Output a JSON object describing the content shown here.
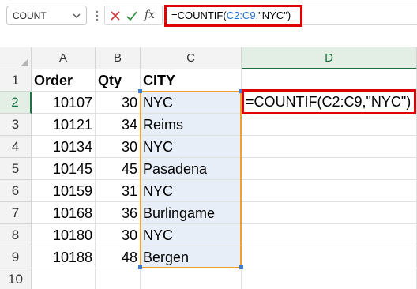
{
  "formula_bar": {
    "name_box": "COUNT",
    "formula_prefix": "=COUNTIF(",
    "formula_ref": "C2:C9",
    "formula_suffix": ",\"NYC\")",
    "fx_label": "fx",
    "icons": [
      "chevron-down-icon",
      "more-options-icon",
      "cancel-x-icon",
      "confirm-check-icon",
      "function-fx-icon"
    ]
  },
  "columns": [
    "A",
    "B",
    "C",
    "D"
  ],
  "rows": [
    "1",
    "2",
    "3",
    "4",
    "5",
    "6",
    "7",
    "8",
    "9",
    "10"
  ],
  "headers": {
    "order": "Order",
    "qty": "Qty",
    "city": "CITY"
  },
  "data": [
    {
      "order": "10107",
      "qty": "30",
      "city": "NYC"
    },
    {
      "order": "10121",
      "qty": "34",
      "city": "Reims"
    },
    {
      "order": "10134",
      "qty": "30",
      "city": "NYC"
    },
    {
      "order": "10145",
      "qty": "45",
      "city": "Pasadena"
    },
    {
      "order": "10159",
      "qty": "31",
      "city": "NYC"
    },
    {
      "order": "10168",
      "qty": "36",
      "city": "Burlingame"
    },
    {
      "order": "10180",
      "qty": "30",
      "city": "NYC"
    },
    {
      "order": "10188",
      "qty": "48",
      "city": "Bergen"
    }
  ],
  "active_cell": {
    "ref": "D2",
    "content": "=COUNTIF(C2:C9,\"NYC\")"
  },
  "colors": {
    "range_highlight": "#f0a030",
    "callout_border": "#e00000",
    "ref_blue": "#1f6fd0",
    "selected_header": "#1e7145"
  }
}
